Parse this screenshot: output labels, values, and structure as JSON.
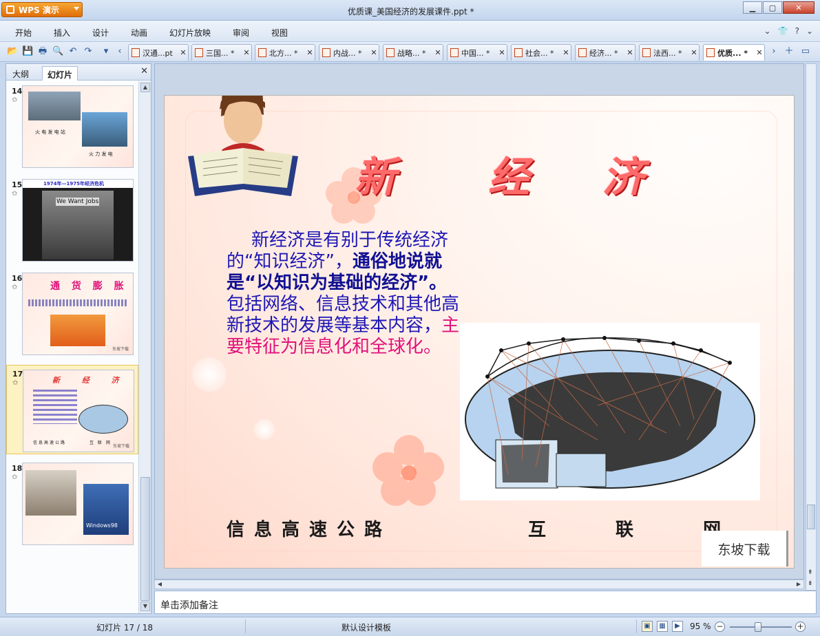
{
  "app": {
    "menu_button_label": "WPS 演示",
    "window_title": "优质课_美国经济的发展课件.ppt *"
  },
  "menu": {
    "items": [
      "开始",
      "插入",
      "设计",
      "动画",
      "幻灯片放映",
      "审阅",
      "视图"
    ]
  },
  "tabs": [
    {
      "label": "汉通...pt",
      "active": false
    },
    {
      "label": "三国... *",
      "active": false
    },
    {
      "label": "北方... *",
      "active": false
    },
    {
      "label": "内战... *",
      "active": false
    },
    {
      "label": "战略... *",
      "active": false
    },
    {
      "label": "中国... *",
      "active": false
    },
    {
      "label": "社会... *",
      "active": false
    },
    {
      "label": "经济... *",
      "active": false
    },
    {
      "label": "法西... *",
      "active": false
    },
    {
      "label": "优质... *",
      "active": true
    }
  ],
  "left_pane": {
    "tab_outline": "大纲",
    "tab_slides": "幻灯片",
    "thumbnails": [
      {
        "num": "14",
        "captions": [
          "火 电 发 电 站",
          "火 力 发 电"
        ]
      },
      {
        "num": "15",
        "title": "1974年—1975年经济危机",
        "captions": [
          "We Want Jobs"
        ]
      },
      {
        "num": "16",
        "title": "通 货 膨 胀",
        "captions": [
          "东坡下载"
        ]
      },
      {
        "num": "17",
        "title": "新 经 济",
        "captions": [
          "信息高速公路",
          "互 联 网",
          "东坡下载"
        ],
        "selected": true
      },
      {
        "num": "18",
        "captions": [
          "Windows98"
        ]
      }
    ]
  },
  "slide": {
    "title_chars": [
      "新",
      "经",
      "济"
    ],
    "body_intro": "新经济是有别于传统经济的“知识经济”，",
    "body_bold": "通俗地说就是“以知识为基础的经济”。",
    "body_mid": "包括网络、信息技术和其他高新技术的发展等基本内容，",
    "body_pink": "主要特征为信息化和全球化。",
    "caption_left": "信息高速公路",
    "caption_right": "互 联 网",
    "watermark": "东坡下载"
  },
  "notes": {
    "placeholder": "单击添加备注"
  },
  "status": {
    "slide_counter": "幻灯片 17 / 18",
    "template": "默认设计模板",
    "zoom": "95 %"
  },
  "colors": {
    "accent": "#e06e0a",
    "body_text": "#1e17b5",
    "highlight": "#e0127a",
    "title": "#ff6a6a"
  }
}
